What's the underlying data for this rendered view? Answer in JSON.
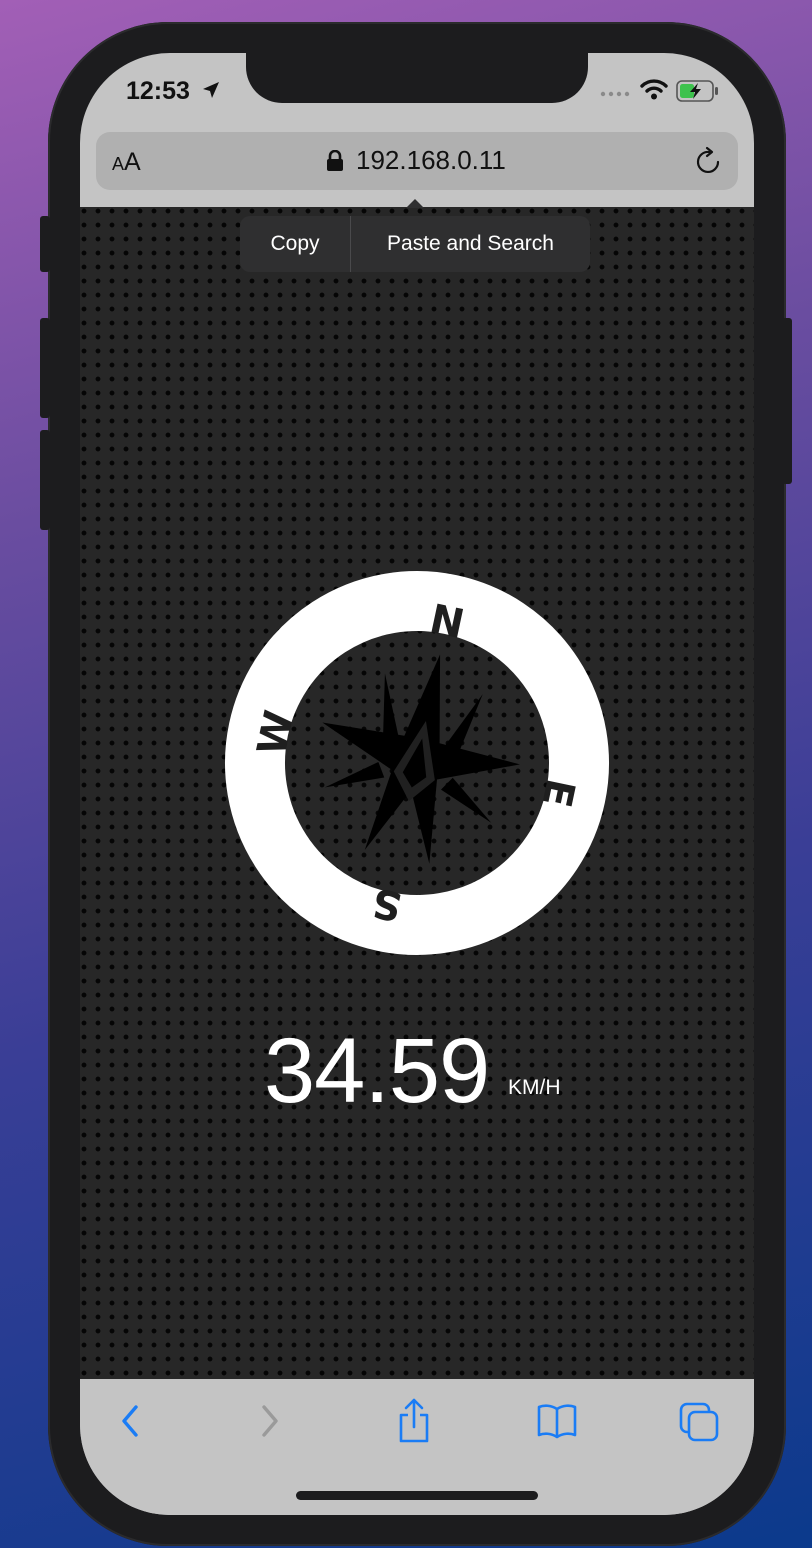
{
  "status_bar": {
    "time": "12:53",
    "icons": [
      "location-arrow-icon",
      "signal-dots-icon",
      "wifi-icon",
      "battery-charging-icon"
    ]
  },
  "address_bar": {
    "text_size_label_small": "A",
    "text_size_label_large": "A",
    "url": "192.168.0.11",
    "icons": [
      "lock-icon",
      "reload-icon"
    ]
  },
  "context_menu": {
    "copy_label": "Copy",
    "paste_search_label": "Paste and Search"
  },
  "compass": {
    "north": "N",
    "east": "E",
    "south": "S",
    "west": "W",
    "rotation_deg": 12
  },
  "speedometer": {
    "speed": "34.59",
    "unit": "KM/H"
  },
  "toolbar": {
    "icons": [
      "back-icon",
      "forward-icon",
      "share-icon",
      "bookmarks-icon",
      "tabs-icon"
    ],
    "accent_color": "#1a7cf5",
    "disabled_color": "#9a9a9a"
  }
}
